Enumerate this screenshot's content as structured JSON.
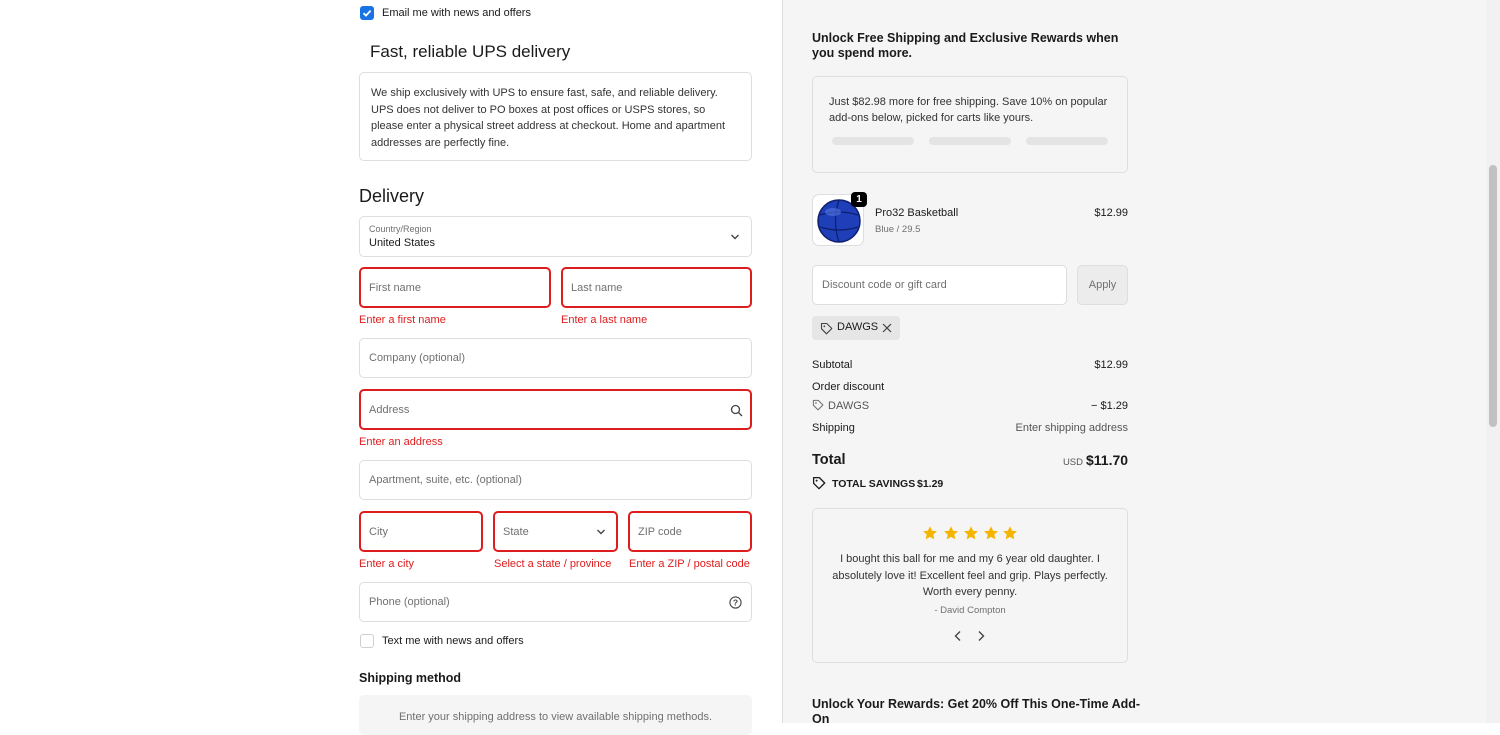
{
  "checkout": {
    "email_opt_in": {
      "label": "Email me with news and offers",
      "checked": true
    },
    "ups": {
      "title": "Fast, reliable UPS delivery",
      "body": "We ship exclusively with UPS to ensure fast, safe, and reliable delivery. UPS does not deliver to PO boxes at post offices or USPS stores, so please enter a physical street address at checkout. Home and apartment addresses are perfectly fine."
    },
    "delivery": {
      "title": "Delivery",
      "country_label": "Country/Region",
      "country_value": "United States",
      "first_name_placeholder": "First name",
      "first_name_error": "Enter a first name",
      "last_name_placeholder": "Last name",
      "last_name_error": "Enter a last name",
      "company_placeholder": "Company (optional)",
      "address_placeholder": "Address",
      "address_error": "Enter an address",
      "apartment_placeholder": "Apartment, suite, etc. (optional)",
      "city_placeholder": "City",
      "city_error": "Enter a city",
      "state_placeholder": "State",
      "state_error": "Select a state / province",
      "zip_placeholder": "ZIP code",
      "zip_error": "Enter a ZIP / postal code",
      "phone_placeholder": "Phone (optional)",
      "sms_opt_in": {
        "label": "Text me with news and offers",
        "checked": false
      }
    },
    "shipping_method": {
      "title": "Shipping method",
      "notice": "Enter your shipping address to view available shipping methods."
    }
  },
  "summary": {
    "rewards_title": "Unlock Free Shipping and Exclusive Rewards when you spend more.",
    "rewards_body": "Just $82.98 more for free shipping. Save 10% on popular add-ons below, picked for carts like yours.",
    "product": {
      "name": "Pro32 Basketball",
      "variant": "Blue / 29.5",
      "price": "$12.99",
      "quantity": "1"
    },
    "discount_placeholder": "Discount code or gift card",
    "apply_label": "Apply",
    "applied_code": "DAWGS",
    "subtotal_label": "Subtotal",
    "subtotal_value": "$12.99",
    "order_discount_label": "Order discount",
    "discount_code": "DAWGS",
    "discount_value": "− $1.29",
    "shipping_label": "Shipping",
    "shipping_value": "Enter shipping address",
    "total_label": "Total",
    "currency": "USD",
    "total_value": "$11.70",
    "savings_label": "TOTAL SAVINGS",
    "savings_value": "$1.29",
    "review": {
      "stars": 5,
      "text": "I bought this ball for me and my 6 year old daughter. I absolutely love it! Excellent feel and grip. Plays perfectly. Worth every penny.",
      "author": "- David Compton"
    },
    "upsell_title": "Unlock Your Rewards: Get 20% Off This One-Time Add-On"
  },
  "colors": {
    "accent": "#1773e6",
    "error": "#dd1d1d",
    "star": "#f5b400"
  }
}
